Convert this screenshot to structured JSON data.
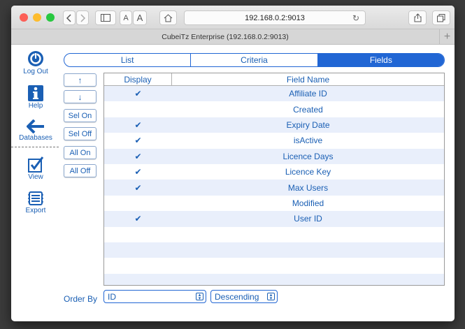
{
  "browser": {
    "address": "192.168.0.2:9013",
    "tab_title": "CubeiTz Enterprise (192.168.0.2:9013)",
    "font_small_label": "A",
    "font_large_label": "A",
    "new_tab_label": "+",
    "colors": {
      "close": "#fc5f57",
      "minimize": "#fdbc2e",
      "zoom": "#28c840"
    }
  },
  "sidebar": {
    "items": [
      {
        "label": "Log Out",
        "icon": "power-icon"
      },
      {
        "label": "Help",
        "icon": "info-icon"
      },
      {
        "label": "Databases",
        "icon": "arrow-left-icon"
      },
      {
        "label": "View",
        "icon": "checkbox-icon"
      },
      {
        "label": "Export",
        "icon": "export-icon"
      }
    ]
  },
  "tabs": [
    {
      "label": "List"
    },
    {
      "label": "Criteria"
    },
    {
      "label": "Fields",
      "active": true
    }
  ],
  "controls": {
    "up": "↑",
    "down": "↓",
    "sel_on": "Sel On",
    "sel_off": "Sel Off",
    "all_on": "All On",
    "all_off": "All Off"
  },
  "table": {
    "headers": {
      "display": "Display",
      "field_name": "Field Name"
    },
    "check_mark": "✔",
    "rows": [
      {
        "checked": true,
        "name": "Affiliate ID"
      },
      {
        "checked": false,
        "name": "Created"
      },
      {
        "checked": true,
        "name": "Expiry Date"
      },
      {
        "checked": true,
        "name": "isActive"
      },
      {
        "checked": true,
        "name": "Licence Days"
      },
      {
        "checked": true,
        "name": "Licence Key"
      },
      {
        "checked": true,
        "name": "Max Users"
      },
      {
        "checked": false,
        "name": "Modified"
      },
      {
        "checked": true,
        "name": "User ID"
      },
      {
        "checked": false,
        "name": ""
      },
      {
        "checked": false,
        "name": ""
      },
      {
        "checked": false,
        "name": ""
      },
      {
        "checked": false,
        "name": ""
      }
    ]
  },
  "order": {
    "label": "Order By",
    "field_value": "ID",
    "direction_value": "Descending"
  },
  "accent": "#2166d4"
}
